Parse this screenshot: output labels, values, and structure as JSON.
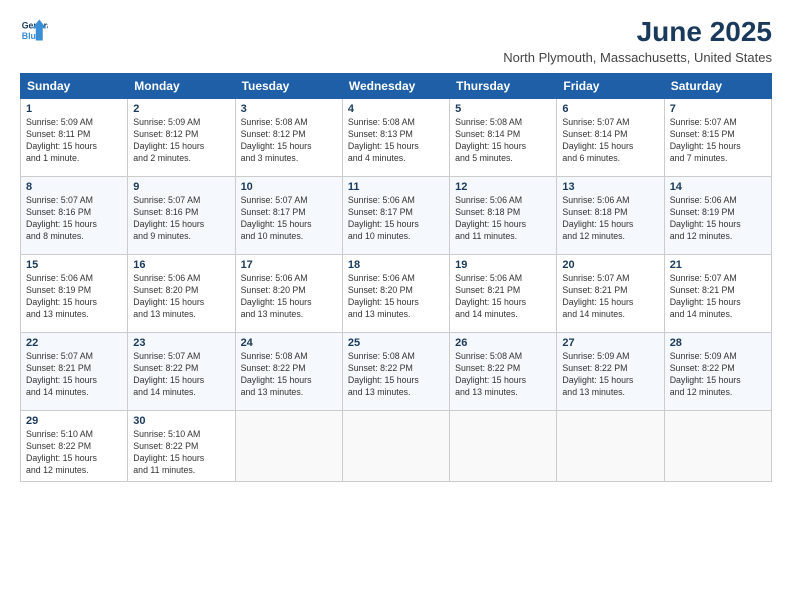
{
  "header": {
    "logo_line1": "General",
    "logo_line2": "Blue",
    "title": "June 2025",
    "subtitle": "North Plymouth, Massachusetts, United States"
  },
  "weekdays": [
    "Sunday",
    "Monday",
    "Tuesday",
    "Wednesday",
    "Thursday",
    "Friday",
    "Saturday"
  ],
  "weeks": [
    [
      {
        "day": 1,
        "lines": [
          "Sunrise: 5:09 AM",
          "Sunset: 8:11 PM",
          "Daylight: 15 hours",
          "and 1 minute."
        ]
      },
      {
        "day": 2,
        "lines": [
          "Sunrise: 5:09 AM",
          "Sunset: 8:12 PM",
          "Daylight: 15 hours",
          "and 2 minutes."
        ]
      },
      {
        "day": 3,
        "lines": [
          "Sunrise: 5:08 AM",
          "Sunset: 8:12 PM",
          "Daylight: 15 hours",
          "and 3 minutes."
        ]
      },
      {
        "day": 4,
        "lines": [
          "Sunrise: 5:08 AM",
          "Sunset: 8:13 PM",
          "Daylight: 15 hours",
          "and 4 minutes."
        ]
      },
      {
        "day": 5,
        "lines": [
          "Sunrise: 5:08 AM",
          "Sunset: 8:14 PM",
          "Daylight: 15 hours",
          "and 5 minutes."
        ]
      },
      {
        "day": 6,
        "lines": [
          "Sunrise: 5:07 AM",
          "Sunset: 8:14 PM",
          "Daylight: 15 hours",
          "and 6 minutes."
        ]
      },
      {
        "day": 7,
        "lines": [
          "Sunrise: 5:07 AM",
          "Sunset: 8:15 PM",
          "Daylight: 15 hours",
          "and 7 minutes."
        ]
      }
    ],
    [
      {
        "day": 8,
        "lines": [
          "Sunrise: 5:07 AM",
          "Sunset: 8:16 PM",
          "Daylight: 15 hours",
          "and 8 minutes."
        ]
      },
      {
        "day": 9,
        "lines": [
          "Sunrise: 5:07 AM",
          "Sunset: 8:16 PM",
          "Daylight: 15 hours",
          "and 9 minutes."
        ]
      },
      {
        "day": 10,
        "lines": [
          "Sunrise: 5:07 AM",
          "Sunset: 8:17 PM",
          "Daylight: 15 hours",
          "and 10 minutes."
        ]
      },
      {
        "day": 11,
        "lines": [
          "Sunrise: 5:06 AM",
          "Sunset: 8:17 PM",
          "Daylight: 15 hours",
          "and 10 minutes."
        ]
      },
      {
        "day": 12,
        "lines": [
          "Sunrise: 5:06 AM",
          "Sunset: 8:18 PM",
          "Daylight: 15 hours",
          "and 11 minutes."
        ]
      },
      {
        "day": 13,
        "lines": [
          "Sunrise: 5:06 AM",
          "Sunset: 8:18 PM",
          "Daylight: 15 hours",
          "and 12 minutes."
        ]
      },
      {
        "day": 14,
        "lines": [
          "Sunrise: 5:06 AM",
          "Sunset: 8:19 PM",
          "Daylight: 15 hours",
          "and 12 minutes."
        ]
      }
    ],
    [
      {
        "day": 15,
        "lines": [
          "Sunrise: 5:06 AM",
          "Sunset: 8:19 PM",
          "Daylight: 15 hours",
          "and 13 minutes."
        ]
      },
      {
        "day": 16,
        "lines": [
          "Sunrise: 5:06 AM",
          "Sunset: 8:20 PM",
          "Daylight: 15 hours",
          "and 13 minutes."
        ]
      },
      {
        "day": 17,
        "lines": [
          "Sunrise: 5:06 AM",
          "Sunset: 8:20 PM",
          "Daylight: 15 hours",
          "and 13 minutes."
        ]
      },
      {
        "day": 18,
        "lines": [
          "Sunrise: 5:06 AM",
          "Sunset: 8:20 PM",
          "Daylight: 15 hours",
          "and 13 minutes."
        ]
      },
      {
        "day": 19,
        "lines": [
          "Sunrise: 5:06 AM",
          "Sunset: 8:21 PM",
          "Daylight: 15 hours",
          "and 14 minutes."
        ]
      },
      {
        "day": 20,
        "lines": [
          "Sunrise: 5:07 AM",
          "Sunset: 8:21 PM",
          "Daylight: 15 hours",
          "and 14 minutes."
        ]
      },
      {
        "day": 21,
        "lines": [
          "Sunrise: 5:07 AM",
          "Sunset: 8:21 PM",
          "Daylight: 15 hours",
          "and 14 minutes."
        ]
      }
    ],
    [
      {
        "day": 22,
        "lines": [
          "Sunrise: 5:07 AM",
          "Sunset: 8:21 PM",
          "Daylight: 15 hours",
          "and 14 minutes."
        ]
      },
      {
        "day": 23,
        "lines": [
          "Sunrise: 5:07 AM",
          "Sunset: 8:22 PM",
          "Daylight: 15 hours",
          "and 14 minutes."
        ]
      },
      {
        "day": 24,
        "lines": [
          "Sunrise: 5:08 AM",
          "Sunset: 8:22 PM",
          "Daylight: 15 hours",
          "and 13 minutes."
        ]
      },
      {
        "day": 25,
        "lines": [
          "Sunrise: 5:08 AM",
          "Sunset: 8:22 PM",
          "Daylight: 15 hours",
          "and 13 minutes."
        ]
      },
      {
        "day": 26,
        "lines": [
          "Sunrise: 5:08 AM",
          "Sunset: 8:22 PM",
          "Daylight: 15 hours",
          "and 13 minutes."
        ]
      },
      {
        "day": 27,
        "lines": [
          "Sunrise: 5:09 AM",
          "Sunset: 8:22 PM",
          "Daylight: 15 hours",
          "and 13 minutes."
        ]
      },
      {
        "day": 28,
        "lines": [
          "Sunrise: 5:09 AM",
          "Sunset: 8:22 PM",
          "Daylight: 15 hours",
          "and 12 minutes."
        ]
      }
    ],
    [
      {
        "day": 29,
        "lines": [
          "Sunrise: 5:10 AM",
          "Sunset: 8:22 PM",
          "Daylight: 15 hours",
          "and 12 minutes."
        ]
      },
      {
        "day": 30,
        "lines": [
          "Sunrise: 5:10 AM",
          "Sunset: 8:22 PM",
          "Daylight: 15 hours",
          "and 11 minutes."
        ]
      },
      null,
      null,
      null,
      null,
      null
    ]
  ]
}
